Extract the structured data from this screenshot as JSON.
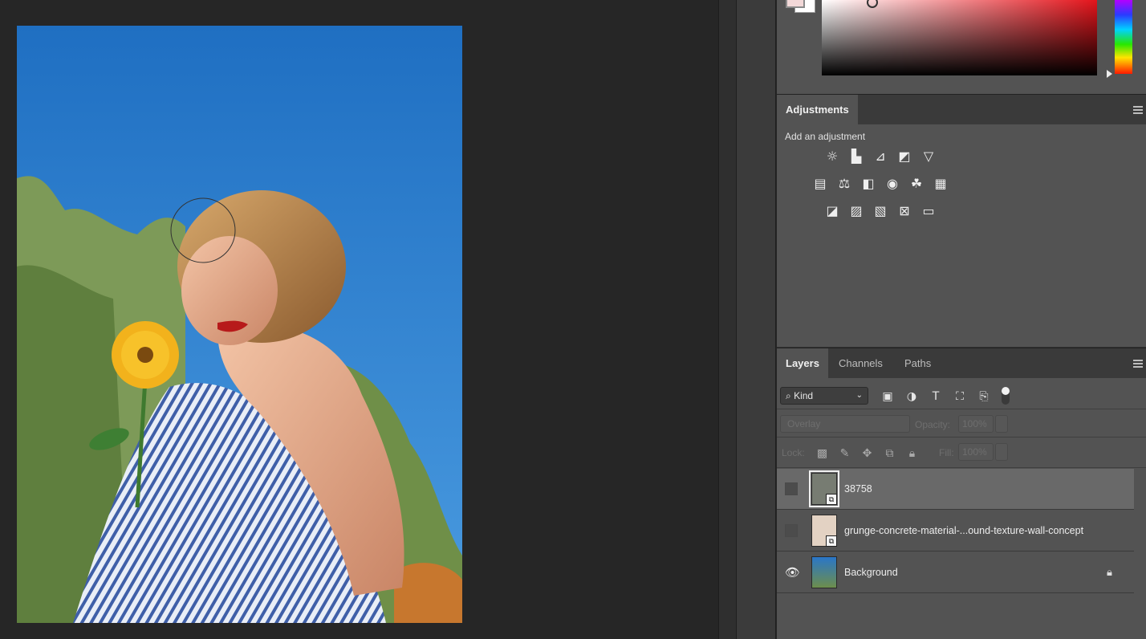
{
  "color_panel": {
    "foreground_color": "#f2d8d8",
    "background_color": "#ffffff",
    "hue_color": "#e4141b"
  },
  "adjustments": {
    "tab_label": "Adjustments",
    "caption": "Add an adjustment",
    "rows": [
      [
        "brightness-contrast-icon",
        "levels-icon",
        "curves-icon",
        "exposure-icon",
        "vibrance-icon"
      ],
      [
        "hue-saturation-icon",
        "color-balance-icon",
        "black-white-icon",
        "photo-filter-icon",
        "channel-mixer-icon",
        "color-lookup-icon"
      ],
      [
        "invert-icon",
        "posterize-icon",
        "threshold-icon",
        "selective-color-icon",
        "gradient-map-icon"
      ]
    ]
  },
  "layers_panel": {
    "tabs": [
      "Layers",
      "Channels",
      "Paths"
    ],
    "active_tab": "Layers",
    "filter_kind": "Kind",
    "filter_icons": [
      "image-filter-icon",
      "adjustment-filter-icon",
      "type-filter-icon",
      "shape-filter-icon",
      "smart-object-filter-icon"
    ],
    "blend_mode": "Overlay",
    "opacity_label": "Opacity:",
    "opacity_value": "100%",
    "lock_label": "Lock:",
    "fill_label": "Fill:",
    "fill_value": "100%",
    "layers": [
      {
        "name": "38758",
        "visible": false,
        "selected": true,
        "smart_object": true,
        "locked": false
      },
      {
        "name": "grunge-concrete-material-...ound-texture-wall-concept",
        "visible": false,
        "selected": false,
        "smart_object": true,
        "locked": false
      },
      {
        "name": "Background",
        "visible": true,
        "selected": false,
        "smart_object": false,
        "locked": true
      }
    ]
  }
}
